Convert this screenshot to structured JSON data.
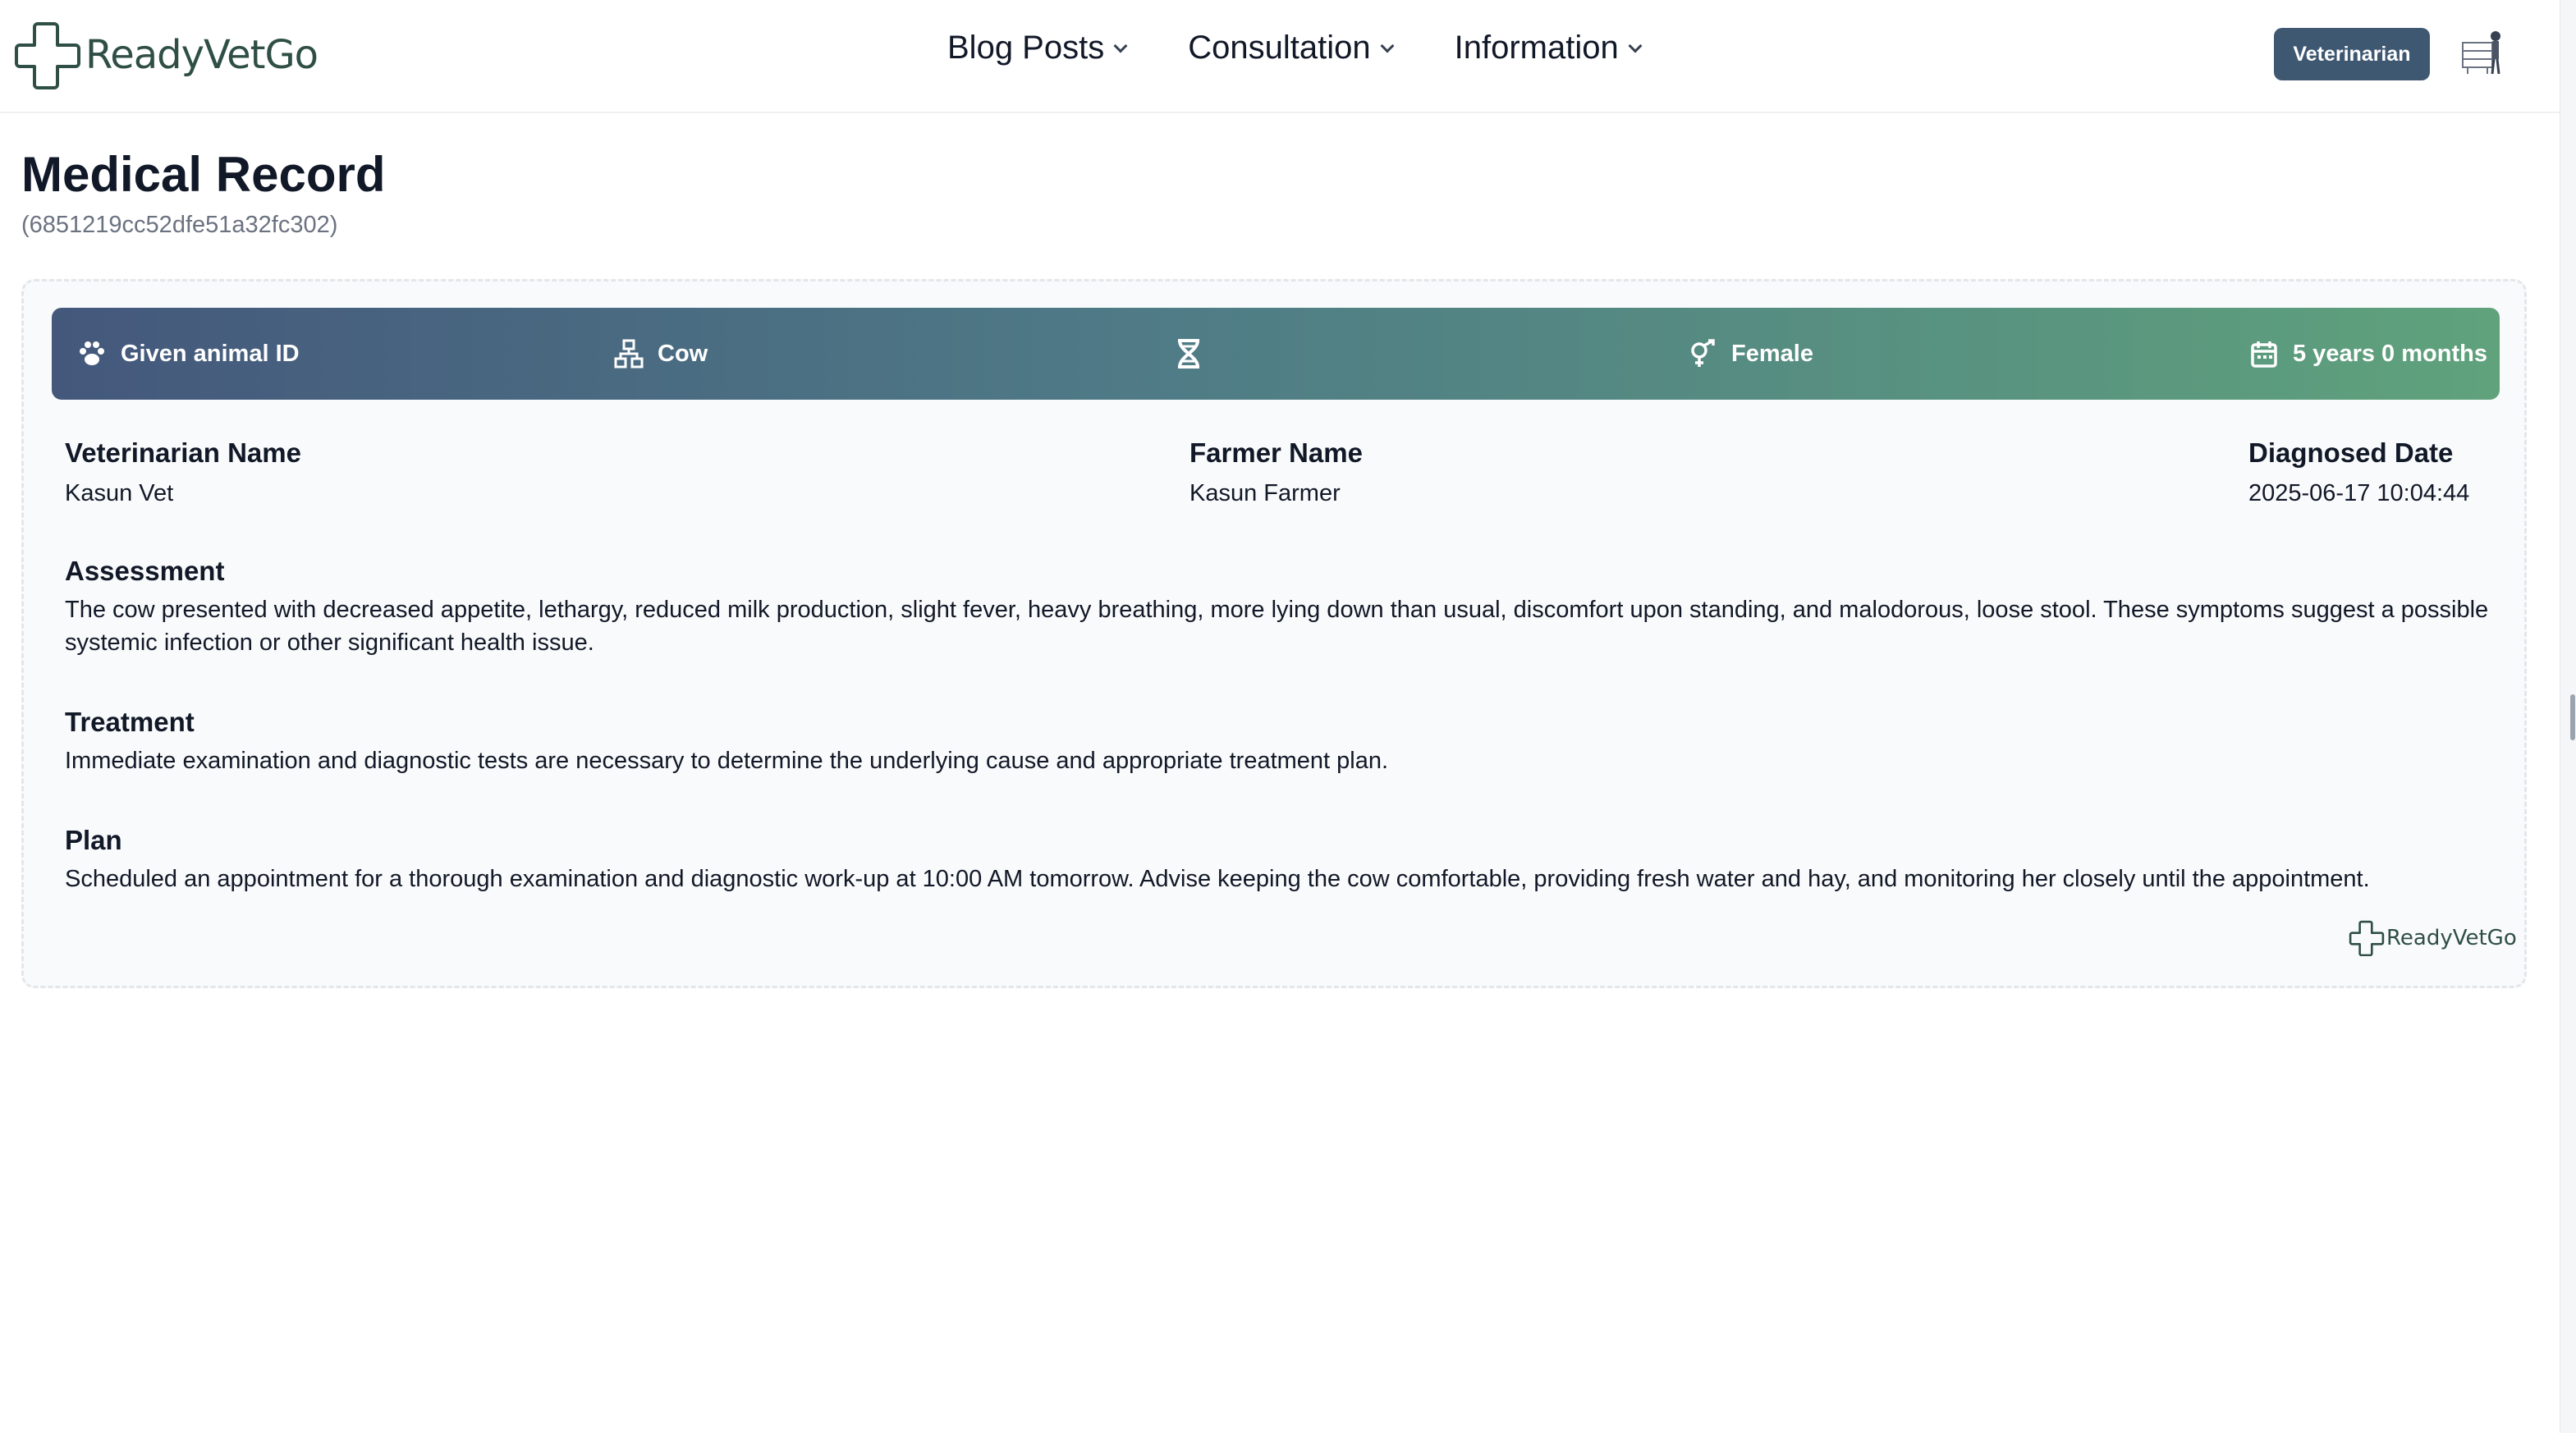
{
  "header": {
    "brand": "ReadyVetGo",
    "nav": [
      {
        "label": "Blog Posts"
      },
      {
        "label": "Consultation"
      },
      {
        "label": "Information"
      }
    ],
    "role_button": "Veterinarian"
  },
  "page": {
    "title": "Medical Record",
    "record_id": "(6851219cc52dfe51a32fc302)"
  },
  "banner": {
    "animal_id": "Given animal ID",
    "species": "Cow",
    "breed": "",
    "sex": "Female",
    "age": "5 years 0 months"
  },
  "details": {
    "vet_label": "Veterinarian Name",
    "vet_value": "Kasun Vet",
    "farmer_label": "Farmer Name",
    "farmer_value": "Kasun Farmer",
    "date_label": "Diagnosed Date",
    "date_value": "2025-06-17 10:04:44"
  },
  "sections": {
    "assessment_title": "Assessment",
    "assessment_text": "The cow presented with decreased appetite, lethargy, reduced milk production, slight fever, heavy breathing, more lying down than usual, discomfort upon standing, and malodorous, loose stool. These symptoms suggest a possible systemic infection or other significant health issue.",
    "treatment_title": "Treatment",
    "treatment_text": "Immediate examination and diagnostic tests are necessary to determine the underlying cause and appropriate treatment plan.",
    "plan_title": "Plan",
    "plan_text": "Scheduled an appointment for a thorough examination and diagnostic work-up at 10:00 AM tomorrow. Advise keeping the cow comfortable, providing fresh water and hay, and monitoring her closely until the appointment."
  },
  "footer": {
    "brand": "ReadyVetGo"
  },
  "colors": {
    "brand": "#2f4f46",
    "role_button": "#3f5872",
    "banner_start": "#44587c",
    "banner_end": "#5fa27c"
  }
}
